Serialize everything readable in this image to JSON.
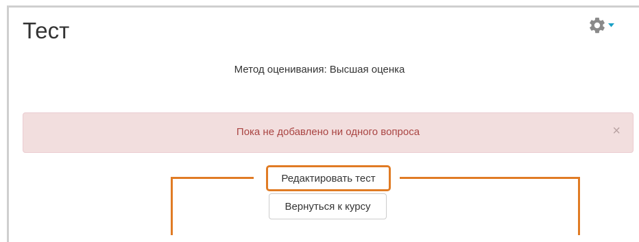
{
  "page": {
    "title": "Тест",
    "grading_method": "Метод оценивания: Высшая оценка"
  },
  "settings_menu": {
    "icon": "gear-icon",
    "dropdown_icon": "caret-down-icon",
    "gear_color": "#8a8a8a",
    "caret_color": "#1aa0c6"
  },
  "alert": {
    "message": "Пока не добавлено ни одного вопроса",
    "close_label": "×",
    "background": "#f2dede",
    "text_color": "#a94442"
  },
  "buttons": {
    "edit_quiz": "Редактировать тест",
    "back_to_course": "Вернуться к курсу"
  },
  "highlight_color": "#e07b24"
}
